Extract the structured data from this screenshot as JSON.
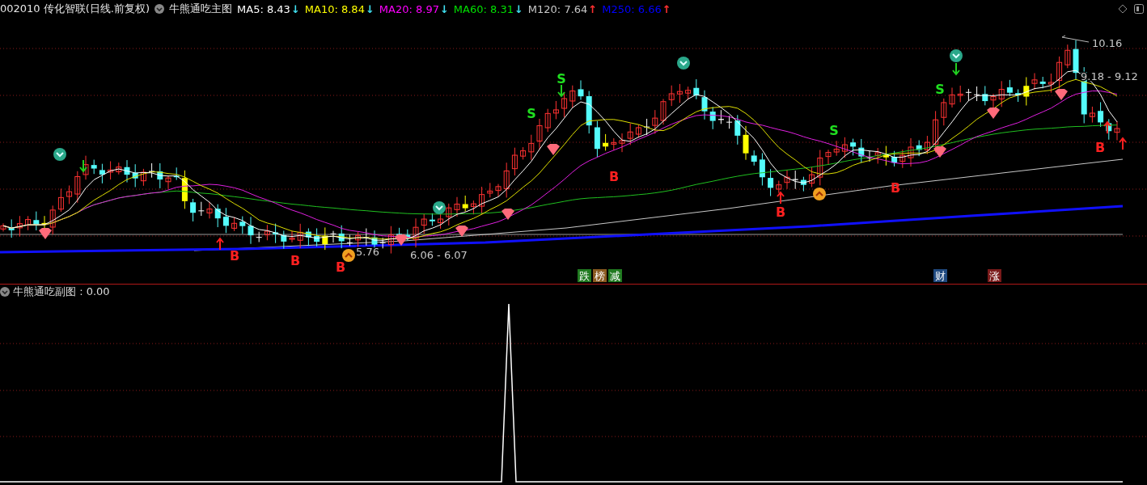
{
  "header": {
    "title": "002010 传化智联(日线.前复权)",
    "indicator": "牛熊通吃主图",
    "averages": [
      {
        "label": "MA5: 8.43",
        "arrow": "↓",
        "rising": false,
        "color": "#ffffff"
      },
      {
        "label": "MA10: 8.84",
        "arrow": "↓",
        "rising": false,
        "color": "#ffff00"
      },
      {
        "label": "MA20: 8.97",
        "arrow": "↓",
        "rising": false,
        "color": "#ff00ff"
      },
      {
        "label": "MA60: 8.31",
        "arrow": "↓",
        "rising": false,
        "color": "#00e000"
      },
      {
        "label": "M120: 7.64",
        "arrow": "↑",
        "rising": true,
        "color": "#c8c8c8"
      },
      {
        "label": "M250: 6.66",
        "arrow": "↑",
        "rising": true,
        "color": "#0000ff"
      }
    ]
  },
  "main_chart": {
    "signals": [
      {
        "kind": "buy",
        "label": "B"
      },
      {
        "kind": "buy",
        "label": "B"
      },
      {
        "kind": "buy",
        "label": "B"
      },
      {
        "kind": "sell",
        "label": "S"
      },
      {
        "kind": "sell",
        "label": "S"
      },
      {
        "kind": "buy",
        "label": "B"
      },
      {
        "kind": "buy",
        "label": "B"
      },
      {
        "kind": "sell",
        "label": "S"
      },
      {
        "kind": "buy",
        "label": "B"
      },
      {
        "kind": "sell",
        "label": "S"
      },
      {
        "kind": "buy",
        "label": "B"
      }
    ],
    "price_labels": [
      "10.16",
      "9.18 - 9.12",
      "5.76",
      "6.06 - 6.07"
    ],
    "event_tags": [
      {
        "label": "跌",
        "color": "#207a20"
      },
      {
        "label": "榜",
        "color": "#8a5a20"
      },
      {
        "label": "减",
        "color": "#207a20"
      },
      {
        "label": "财",
        "color": "#204a80"
      },
      {
        "label": "涨",
        "color": "#7a1a1a"
      }
    ]
  },
  "sub_chart": {
    "title": "牛熊通吃副图 : 0.00"
  }
}
